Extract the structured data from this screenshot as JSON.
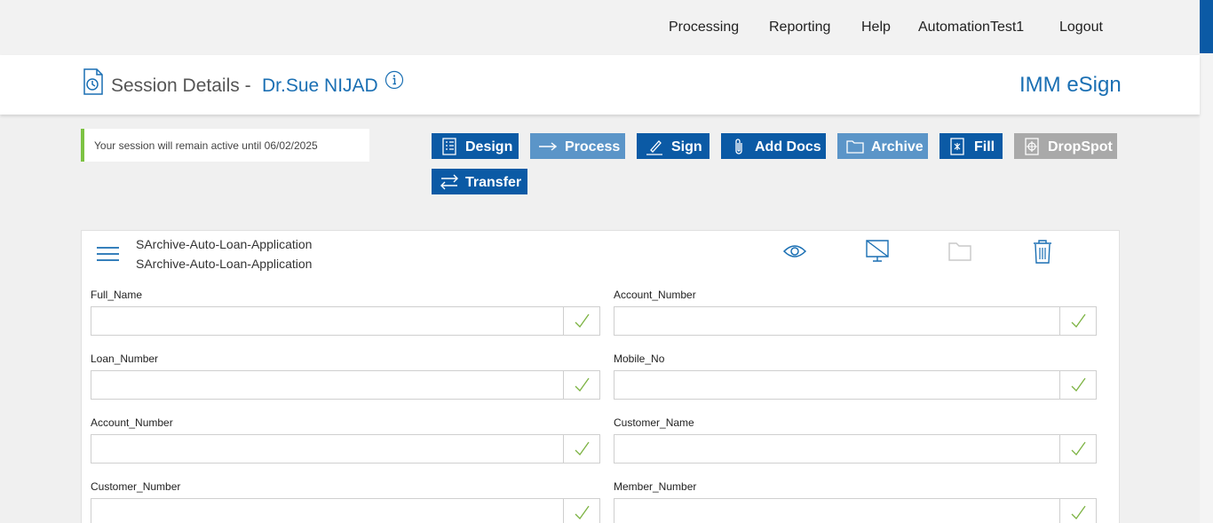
{
  "nav": {
    "items": [
      "Processing",
      "Reporting",
      "Help",
      "AutomationTest1",
      "Logout"
    ]
  },
  "header": {
    "title": "Session Details -",
    "person": "Dr.Sue NIJAD",
    "brand": "IMM eSign",
    "icons": [
      "session-history-icon",
      "info-icon"
    ]
  },
  "session": {
    "notice": "Your session will remain active until 06/02/2025"
  },
  "toolbar": {
    "buttons": [
      {
        "label": "Design",
        "icon": "list-icon"
      },
      {
        "label": "Process",
        "icon": "arrow-right-icon"
      },
      {
        "label": "Sign",
        "icon": "pen-icon"
      },
      {
        "label": "Add Docs",
        "icon": "paperclip-icon"
      },
      {
        "label": "Archive",
        "icon": "folder-icon"
      },
      {
        "label": "Fill",
        "icon": "document-asterisk-icon"
      },
      {
        "label": "DropSpot",
        "icon": "target-icon"
      },
      {
        "label": "Transfer",
        "icon": "swap-arrows-icon"
      }
    ]
  },
  "document": {
    "name_line1": "SArchive-Auto-Loan-Application",
    "name_line2": "SArchive-Auto-Loan-Application",
    "actions": [
      "eye-icon",
      "monitor-off-icon",
      "folder-icon",
      "trash-icon"
    ]
  },
  "fields": [
    {
      "label": "Full_Name",
      "value": ""
    },
    {
      "label": "Account_Number",
      "value": ""
    },
    {
      "label": "Loan_Number",
      "value": ""
    },
    {
      "label": "Mobile_No",
      "value": ""
    },
    {
      "label": "Account_Number",
      "value": ""
    },
    {
      "label": "Customer_Name",
      "value": ""
    },
    {
      "label": "Customer_Number",
      "value": ""
    },
    {
      "label": "Member_Number",
      "value": ""
    }
  ],
  "colors": {
    "primary": "#0b5aa5",
    "light_button": "#5b95c8",
    "disabled_button": "#a9a9a9",
    "brand_text": "#1a6fb3",
    "session_accent": "#7cc242",
    "check": "#7cb342"
  }
}
